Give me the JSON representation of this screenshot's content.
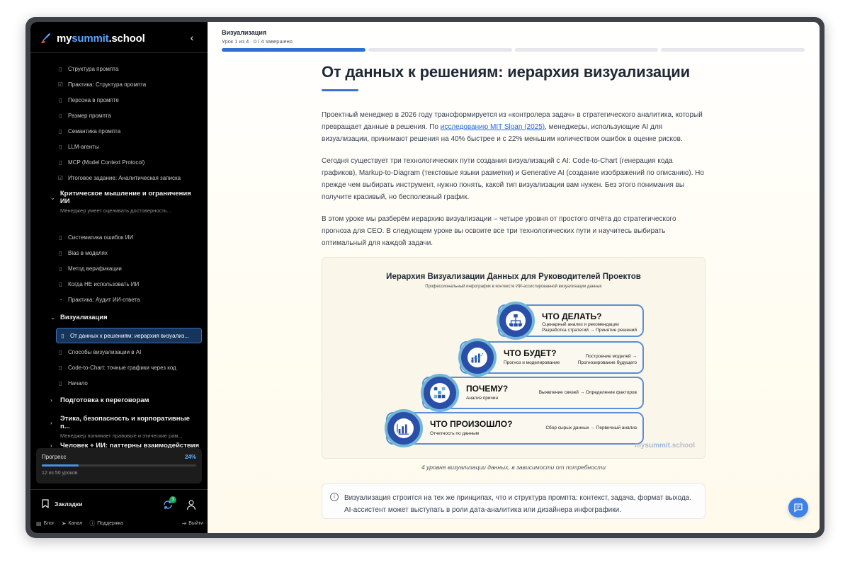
{
  "brand": {
    "prefix": "my",
    "accent": "summit",
    "suffix": ".school"
  },
  "sidebar": {
    "items": [
      {
        "label": "Структура промпта",
        "icon": "doc-icon"
      },
      {
        "label": "Практика: Структура промпта",
        "icon": "check-doc-icon"
      },
      {
        "label": "Персона в промпте",
        "icon": "doc-icon"
      },
      {
        "label": "Размер промпта",
        "icon": "doc-icon"
      },
      {
        "label": "Семантика промпта",
        "icon": "doc-icon"
      },
      {
        "label": "LLM-агенты",
        "icon": "doc-icon"
      },
      {
        "label": "MCP (Model Context Protocol)",
        "icon": "doc-icon"
      },
      {
        "label": "Итоговое задание: Аналитическая записка",
        "icon": "check-doc-icon"
      }
    ],
    "section_critical": {
      "title": "Критическое мышление и ограничения ИИ",
      "subtitle": "Менеджер умеет оценивать достоверность..."
    },
    "critical_items": [
      {
        "label": "Систематика ошибок ИИ"
      },
      {
        "label": "Bias в моделях"
      },
      {
        "label": "Метод верификации"
      },
      {
        "label": "Когда НЕ использовать ИИ"
      },
      {
        "label": "Практика: Аудит ИИ-ответа"
      }
    ],
    "section_viz": {
      "title": "Визуализация"
    },
    "viz_items": [
      {
        "label": "От данных к решениям: иерархия визуализ..."
      },
      {
        "label": "Способы визуализации в AI"
      },
      {
        "label": "Code-to-Chart: точные графики через код"
      },
      {
        "label": "Начало"
      }
    ],
    "section_negotiation": {
      "title": "Подготовка к переговорам"
    },
    "section_ethics": {
      "title": "Этика, безопасность и корпоративные п...",
      "subtitle": "Менеджер понимает правовые и этические рам..."
    },
    "section_human": {
      "title": "Человек + ИИ: паттерны взаимодействия"
    },
    "progress": {
      "label": "Прогресс",
      "percent_text": "24%",
      "fraction": 0.24,
      "lessons": "12 из 50 уроков"
    },
    "bookmarks_label": "Закладки",
    "sync_badge": "3",
    "footer": {
      "blog": "Блог",
      "channel": "Канал",
      "support": "Поддержка",
      "logout": "Выйти"
    }
  },
  "topbar": {
    "title": "Визуализация",
    "subtitle": "Урок 1 из 4 · 0 / 4 завершено",
    "segments_done": 1,
    "segments_total": 4
  },
  "article": {
    "title": "От данных к решениям: иерархия визуализации",
    "p1_before": "Проектный менеджер в 2026 году трансформируется из «контролера задач» в стратегического аналитика, который превращает данные в решения. По ",
    "p1_link": "исследованию MIT Sloan (2025)",
    "p1_after": ", менеджеры, использующие AI для визуализации, принимают решения на 40% быстрее и с 22% меньшим количеством ошибок в оценке рисков.",
    "p2": "Сегодня существует три технологических пути создания визуализаций с AI: Code-to-Chart (генерация кода графиков), Markup-to-Diagram (текстовые языки разметки) и Generative AI (создание изображений по описанию). Но прежде чем выбирать инструмент, нужно понять, какой тип визуализации вам нужен. Без этого понимания вы получите красивый, но бесполезный график.",
    "p3": "В этом уроке мы разберём иерархию визуализации – четыре уровня от простого отчёта до стратегического прогноза для CEO. В следующем уроке вы освоите все три технологических пути и научитесь выбирать оптимальный для каждой задачи.",
    "caption": "4 уровня визуализации данных, в зависимости от потребности",
    "note": "Визуализация строится на тех же принципах, что и структура промпта: контекст, задача, формат выхода. AI-ассистент может выступать в роли дата-аналитика или дизайнера инфографики."
  },
  "figure": {
    "title": "Иерархия Визуализации Данных для Руководителей Проектов",
    "subtitle": "Профессиональный инфографик в контексте ИИ-ассистированной визуализации данных",
    "levels": [
      {
        "title": "ЧТО ДЕЛАТЬ?",
        "line1": "Сценарный анализ и рекомендации",
        "line2": "Разработка стратегий → Принятие решений",
        "icon": "org-chart-icon"
      },
      {
        "title": "ЧТО БУДЕТ?",
        "sub": "Прогноз и моделирование",
        "right1": "Построение моделей →",
        "right2": "Прогнозирование будущего",
        "icon": "trend-chart-icon"
      },
      {
        "title": "ПОЧЕМУ?",
        "sub": "Анализ причин",
        "right1": "Выявление связей → Определение факторов",
        "icon": "matrix-icon"
      },
      {
        "title": "ЧТО ПРОИЗОШЛО?",
        "sub": "Отчетность по данным",
        "right1": "Сбор сырых данных → Первичный анализ",
        "icon": "bar-chart-icon"
      }
    ],
    "watermark_prefix": "my",
    "watermark_accent": "summit",
    "watermark_suffix": ".school"
  },
  "colors": {
    "accent": "#2f6fd6",
    "sidebar_bg": "#000000",
    "active_item": "#17345c",
    "step_circle": "#2a4fa8",
    "step_ring": "#71b6d9"
  }
}
